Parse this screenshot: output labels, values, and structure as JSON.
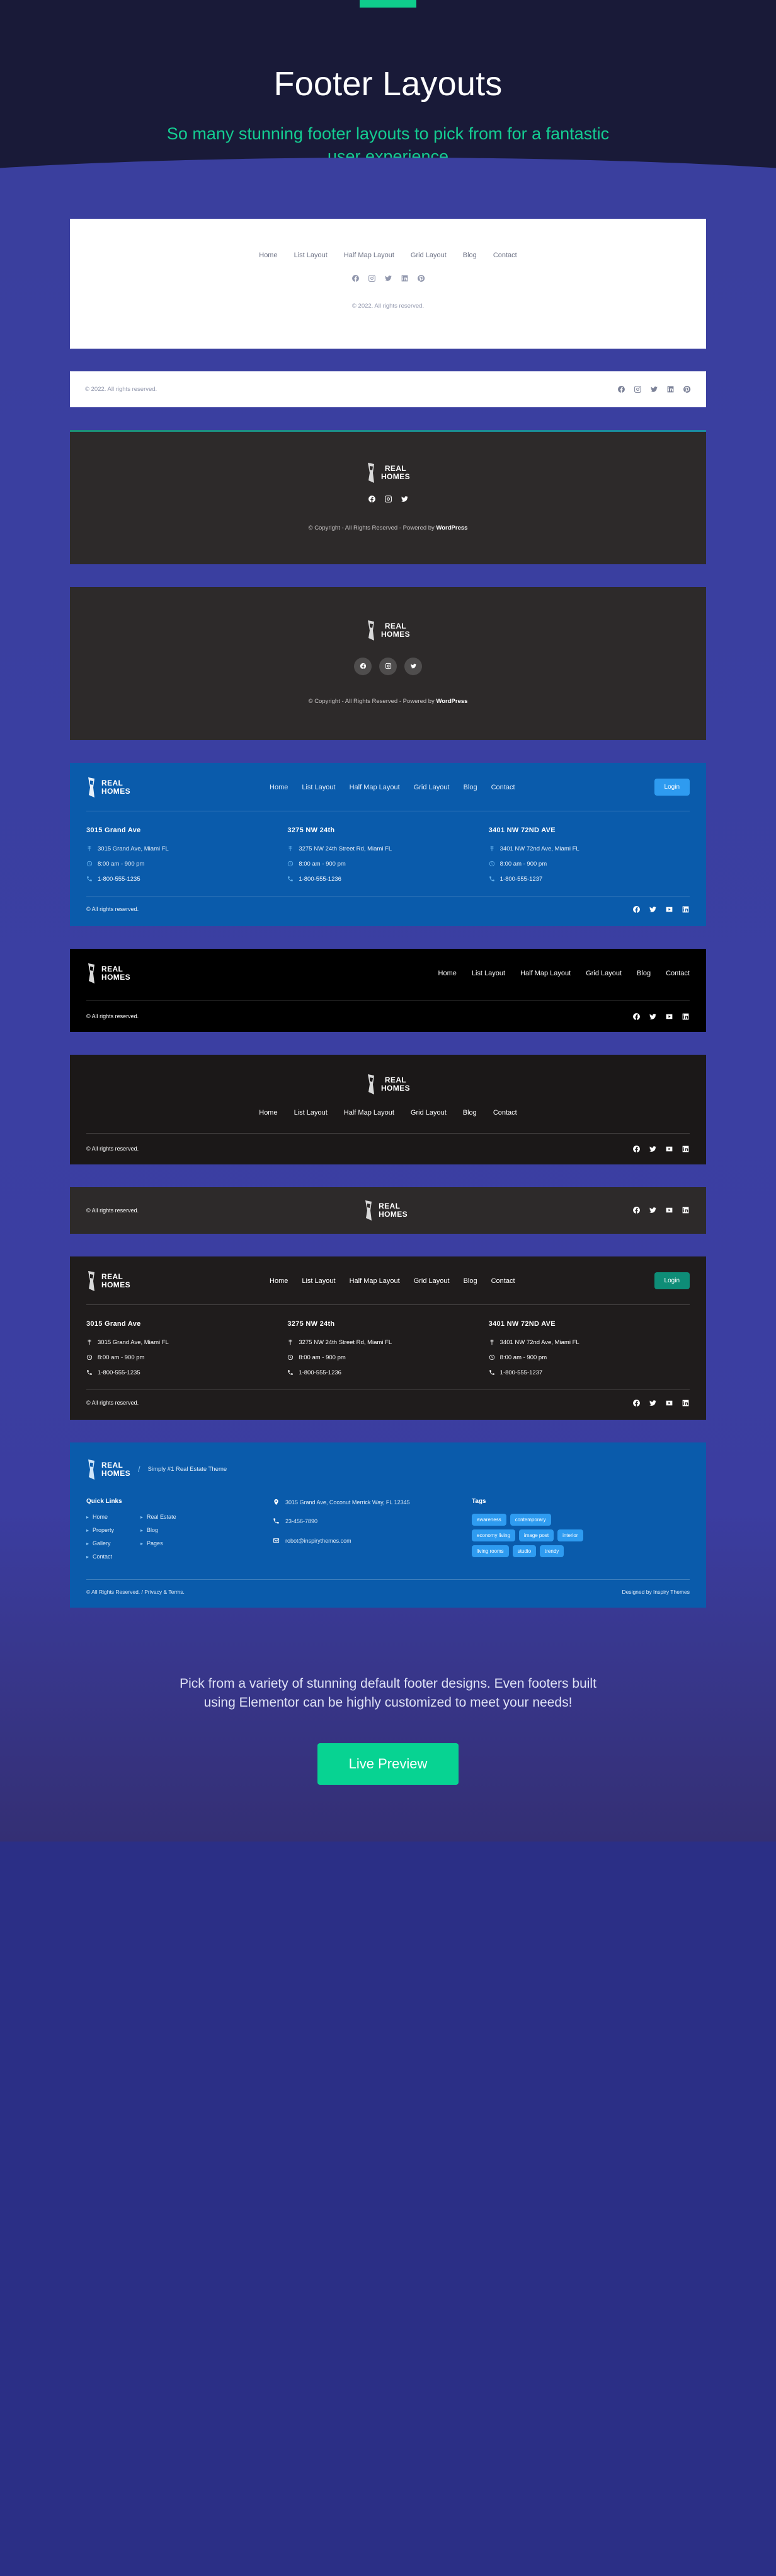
{
  "hero": {
    "title": "Footer Layouts",
    "subtitle": "So many stunning footer layouts to pick from for a fantastic user experience"
  },
  "brand": {
    "name_line1": "REAL",
    "name_line2": "HOMES",
    "tagline": "Simply #1 Real Estate Theme"
  },
  "nav": {
    "home": "Home",
    "list_layout": "List Layout",
    "half_map_layout": "Half Map Layout",
    "grid_layout": "Grid Layout",
    "blog": "Blog",
    "contact": "Contact"
  },
  "labels": {
    "copyright_2022": "© 2022. All rights reserved.",
    "copyright_all": "© All rights reserved.",
    "copyright_wp_pre": "© Copyright - All Rights Reserved - Powered by ",
    "copyright_wp_brand": "WordPress",
    "login": "Login",
    "rights_privacy": "© All Rights Reserved. / Privacy & Terms.",
    "designed_by": "Designed by Inspiry Themes",
    "quick_links": "Quick Links",
    "tags": "Tags"
  },
  "offices": [
    {
      "title": "3015 Grand Ave",
      "address": "3015 Grand Ave, Miami FL",
      "hours": "8:00 am - 900 pm",
      "phone": "1-800-555-1235"
    },
    {
      "title": "3275 NW 24th",
      "address": "3275 NW 24th Street Rd, Miami FL",
      "hours": "8:00 am - 900 pm",
      "phone": "1-800-555-1236"
    },
    {
      "title": "3401 NW 72ND AVE",
      "address": "3401 NW 72nd Ave, Miami FL",
      "hours": "8:00 am - 900 pm",
      "phone": "1-800-555-1237"
    }
  ],
  "quick_links_col1": [
    "Home",
    "Property",
    "Gallery",
    "Contact"
  ],
  "quick_links_col2": [
    "Real Estate",
    "Blog",
    "Pages"
  ],
  "contact": {
    "address": "3015 Grand Ave, Coconut Merrick Way, FL 12345",
    "phone": "23-456-7890",
    "email": "robot@inspirythemes.com"
  },
  "tags": [
    "awareness",
    "contemporary",
    "economy living",
    "image post",
    "interior",
    "living rooms",
    "studio",
    "trendy"
  ],
  "cta": {
    "text": "Pick from a variety of stunning default footer designs. Even footers built using Elementor can be highly customized to meet your needs!",
    "button": "Live Preview"
  },
  "colors": {
    "accent_green": "#07d392",
    "hero_bg": "#191a38",
    "page_blue": "#3a3f9e",
    "brand_blue": "#0a5bab",
    "light_blue": "#2e9bf0",
    "teal_button": "#0e8d77"
  },
  "icons": {
    "facebook": "facebook-icon",
    "instagram": "instagram-icon",
    "twitter": "twitter-icon",
    "linkedin": "linkedin-icon",
    "pinterest": "pinterest-icon",
    "youtube": "youtube-icon",
    "map_pin": "map-pin-icon",
    "clock": "clock-icon",
    "phone": "phone-icon",
    "mail": "mail-icon"
  }
}
